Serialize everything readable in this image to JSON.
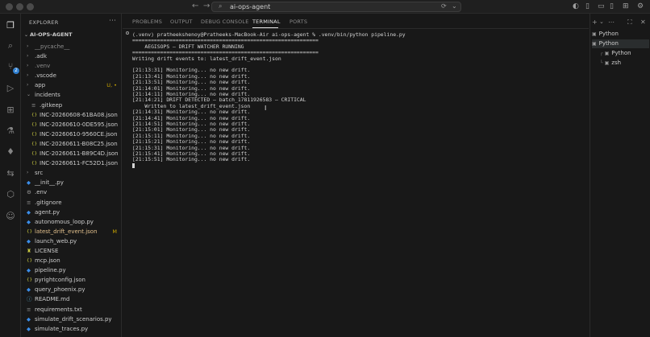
{
  "window": {
    "title": "ai-ops-agent"
  },
  "titlebar_icons": [
    "back-arrow-icon",
    "forward-arrow-icon"
  ],
  "explorer": {
    "header": "EXPLORER",
    "root": "AI-OPS-AGENT",
    "items": [
      {
        "label": "__pycache__",
        "type": "folder",
        "depth": 1,
        "open": false,
        "git": "ignored"
      },
      {
        "label": ".adk",
        "type": "folder",
        "depth": 1,
        "open": false
      },
      {
        "label": ".venv",
        "type": "folder",
        "depth": 1,
        "open": false,
        "git": "ignored"
      },
      {
        "label": ".vscode",
        "type": "folder",
        "depth": 1,
        "open": false
      },
      {
        "label": "app",
        "type": "folder",
        "depth": 1,
        "open": false,
        "status": "U, •"
      },
      {
        "label": "incidents",
        "type": "folder",
        "depth": 1,
        "open": true
      },
      {
        "label": ".gitkeep",
        "type": "file",
        "depth": 2,
        "icon": "lines"
      },
      {
        "label": "INC-20260608-61BA08.json",
        "type": "json",
        "depth": 2
      },
      {
        "label": "INC-20260610-0DE595.json",
        "type": "json",
        "depth": 2
      },
      {
        "label": "INC-20260610-9560CE.json",
        "type": "json",
        "depth": 2
      },
      {
        "label": "INC-20260611-B08C25.json",
        "type": "json",
        "depth": 2
      },
      {
        "label": "INC-20260611-B89C4D.json",
        "type": "json",
        "depth": 2
      },
      {
        "label": "INC-20260611-FC52D1.json",
        "type": "json",
        "depth": 2
      },
      {
        "label": "src",
        "type": "folder",
        "depth": 1,
        "open": false
      },
      {
        "label": "__init__.py",
        "type": "py",
        "depth": 1
      },
      {
        "label": ".env",
        "type": "gear",
        "depth": 1
      },
      {
        "label": ".gitignore",
        "type": "file",
        "depth": 1,
        "icon": "lines"
      },
      {
        "label": "agent.py",
        "type": "py",
        "depth": 1
      },
      {
        "label": "autonomous_loop.py",
        "type": "py",
        "depth": 1
      },
      {
        "label": "latest_drift_event.json",
        "type": "json",
        "depth": 1,
        "status": "M",
        "git": "modified"
      },
      {
        "label": "launch_web.py",
        "type": "py",
        "depth": 1
      },
      {
        "label": "LICENSE",
        "type": "license",
        "depth": 1
      },
      {
        "label": "mcp.json",
        "type": "json",
        "depth": 1
      },
      {
        "label": "pipeline.py",
        "type": "py",
        "depth": 1
      },
      {
        "label": "pyrightconfig.json",
        "type": "json",
        "depth": 1
      },
      {
        "label": "query_phoenix.py",
        "type": "py",
        "depth": 1
      },
      {
        "label": "README.md",
        "type": "info",
        "depth": 1
      },
      {
        "label": "requirements.txt",
        "type": "file",
        "depth": 1,
        "icon": "lines"
      },
      {
        "label": "simulate_drift_scenarios.py",
        "type": "py",
        "depth": 1
      },
      {
        "label": "simulate_traces.py",
        "type": "py",
        "depth": 1
      }
    ]
  },
  "panel": {
    "tabs": [
      {
        "label": "PROBLEMS",
        "active": false
      },
      {
        "label": "OUTPUT",
        "active": false
      },
      {
        "label": "DEBUG CONSOLE",
        "active": false
      },
      {
        "label": "TERMINAL",
        "active": true
      },
      {
        "label": "PORTS",
        "active": false
      }
    ]
  },
  "terminal": {
    "lines": [
      "(.venv) pratheekshenoy@Pratheeks-MacBook-Air ai-ops-agent % .venv/bin/python pipeline.py",
      "============================================================",
      "    AEGISOPS — DRIFT WATCHER RUNNING",
      "============================================================",
      "Writing drift events to: latest_drift_event.json",
      "",
      "[21:13:31] Monitoring... no new drift.",
      "[21:13:41] Monitoring... no new drift.",
      "[21:13:51] Monitoring... no new drift.",
      "[21:14:01] Monitoring... no new drift.",
      "[21:14:11] Monitoring... no new drift.",
      "[21:14:21] DRIFT DETECTED — batch_17811926583 — CRITICAL",
      "    Written to latest_drift_event.json",
      "[21:14:31] Monitoring... no new drift.",
      "[21:14:41] Monitoring... no new drift.",
      "[21:14:51] Monitoring... no new drift.",
      "[21:15:01] Monitoring... no new drift.",
      "[21:15:11] Monitoring... no new drift.",
      "[21:15:21] Monitoring... no new drift.",
      "[21:15:31] Monitoring... no new drift.",
      "[21:15:41] Monitoring... no new drift.",
      "[21:15:51] Monitoring... no new drift."
    ]
  },
  "terminal_list": [
    {
      "label": "Python",
      "active": false,
      "child": false
    },
    {
      "label": "Python",
      "active": true,
      "child": false
    },
    {
      "label": "Python",
      "active": false,
      "child": true
    },
    {
      "label": "zsh",
      "active": false,
      "child": true
    }
  ],
  "colors": {
    "background": "#181818",
    "accent": "#2f7fd0",
    "git_modified": "#e2c08d",
    "json_icon": "#cbcb41",
    "python_icon": "#3b8eea"
  }
}
